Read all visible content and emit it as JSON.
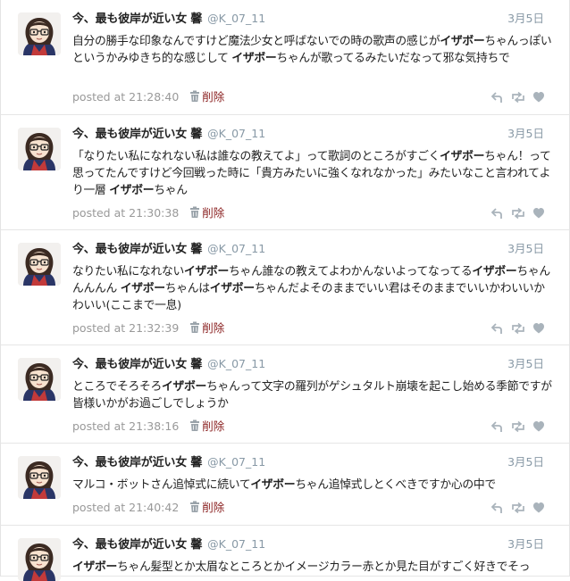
{
  "tweets": [
    {
      "name": "今、最も彼岸が近い女 馨",
      "handle": "@K_07_11",
      "date": "3月5日",
      "posted_label": "posted at",
      "time": "21:28:40",
      "delete_label": "削除",
      "segments": [
        {
          "t": "自分の勝手な印象なんですけど魔法少女と呼ばないでの時の歌声の感じが",
          "b": false
        },
        {
          "t": "イザボー",
          "b": true
        },
        {
          "t": "ちゃんっぽいというかみゆきち的な感じして ",
          "b": false
        },
        {
          "t": "イザボー",
          "b": true
        },
        {
          "t": "ちゃんが歌ってるみたいだなって邪な気持ちで",
          "b": false
        }
      ]
    },
    {
      "name": "今、最も彼岸が近い女 馨",
      "handle": "@K_07_11",
      "date": "3月5日",
      "posted_label": "posted at",
      "time": "21:30:38",
      "delete_label": "削除",
      "segments": [
        {
          "t": "「なりたい私になれない私は誰なの教えてよ」って歌詞のところがすごく",
          "b": false
        },
        {
          "t": "イザボー",
          "b": true
        },
        {
          "t": "ちゃん！って思ってたんですけど今回戦った時に「貴方みたいに強くなれなかった」みたいなこと言われてより一層 ",
          "b": false
        },
        {
          "t": "イザボー",
          "b": true
        },
        {
          "t": "ちゃん",
          "b": false
        }
      ]
    },
    {
      "name": "今、最も彼岸が近い女 馨",
      "handle": "@K_07_11",
      "date": "3月5日",
      "posted_label": "posted at",
      "time": "21:32:39",
      "delete_label": "削除",
      "segments": [
        {
          "t": "なりたい私になれない",
          "b": false
        },
        {
          "t": "イザボー",
          "b": true
        },
        {
          "t": "ちゃん誰なの教えてよわかんないよってなってる",
          "b": false
        },
        {
          "t": "イザボー",
          "b": true
        },
        {
          "t": "ちゃんんんんん ",
          "b": false
        },
        {
          "t": "イザボー",
          "b": true
        },
        {
          "t": "ちゃんは",
          "b": false
        },
        {
          "t": "イザボー",
          "b": true
        },
        {
          "t": "ちゃんだよそのままでいい君はそのままでいいかわいいかわいい(ここまで一息)",
          "b": false
        }
      ]
    },
    {
      "name": "今、最も彼岸が近い女 馨",
      "handle": "@K_07_11",
      "date": "3月5日",
      "posted_label": "posted at",
      "time": "21:38:16",
      "delete_label": "削除",
      "segments": [
        {
          "t": "ところでそろそろ",
          "b": false
        },
        {
          "t": "イザボー",
          "b": true
        },
        {
          "t": "ちゃんって文字の羅列がゲシュタルト崩壊を起こし始める季節ですが皆様いかがお過ごしでしょうか",
          "b": false
        }
      ]
    },
    {
      "name": "今、最も彼岸が近い女 馨",
      "handle": "@K_07_11",
      "date": "3月5日",
      "posted_label": "posted at",
      "time": "21:40:42",
      "delete_label": "削除",
      "segments": [
        {
          "t": "マルコ・ボットさん追悼式に続いて",
          "b": false
        },
        {
          "t": "イザボー",
          "b": true
        },
        {
          "t": "ちゃん追悼式しとくべきですか心の中で",
          "b": false
        }
      ]
    },
    {
      "name": "今、最も彼岸が近い女 馨",
      "handle": "@K_07_11",
      "date": "3月5日",
      "posted_label": "posted at",
      "time": "",
      "delete_label": "",
      "segments": [
        {
          "t": "イザボー",
          "b": true
        },
        {
          "t": "ちゃん髪型とか太眉なところとかイメージカラー赤とか見た目がすごく好きでそっ",
          "b": false
        }
      ]
    }
  ],
  "icons": [
    "reply-icon",
    "retweet-icon",
    "favorite-icon",
    "trash-icon"
  ],
  "colors": {
    "name": "#222222",
    "handle": "#8899a6",
    "meta": "#999999",
    "delete": "#8a2020",
    "action_icon": "#a9b3bb",
    "divider": "#e6e6e6"
  }
}
